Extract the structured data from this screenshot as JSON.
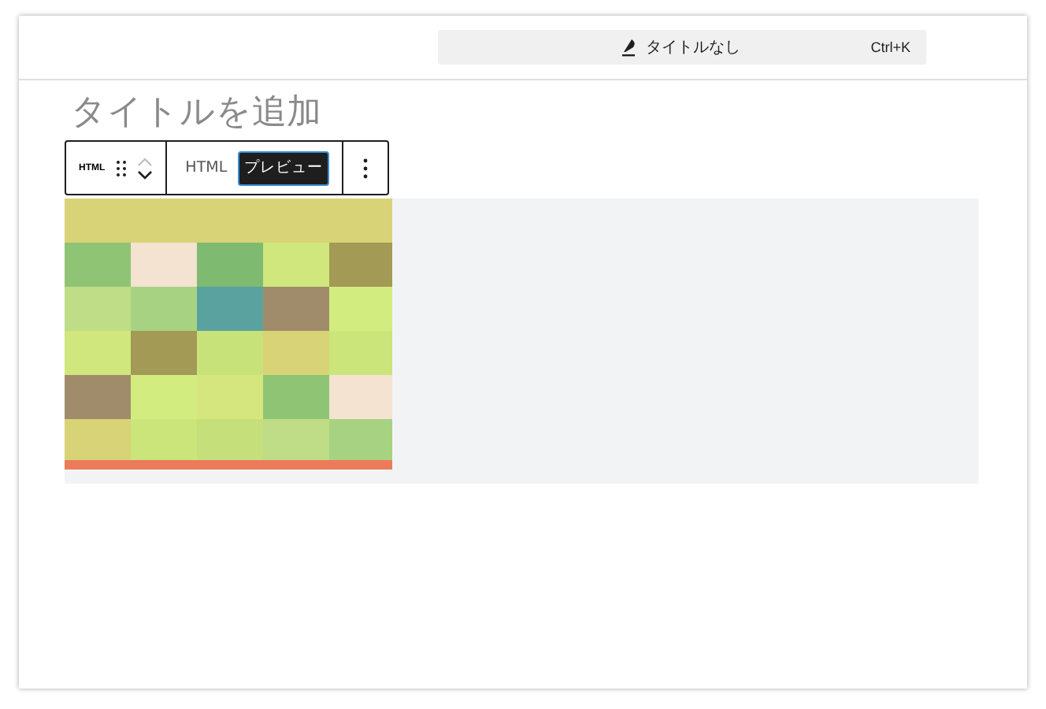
{
  "header": {
    "command_bar": {
      "title": "タイトルなし",
      "shortcut": "Ctrl+K"
    }
  },
  "editor": {
    "title_placeholder": "タイトルを追加",
    "toolbar": {
      "block_type": "HTML",
      "tabs": [
        {
          "label": "HTML",
          "selected": false
        },
        {
          "label": "プレビュー",
          "selected": true
        }
      ]
    }
  }
}
